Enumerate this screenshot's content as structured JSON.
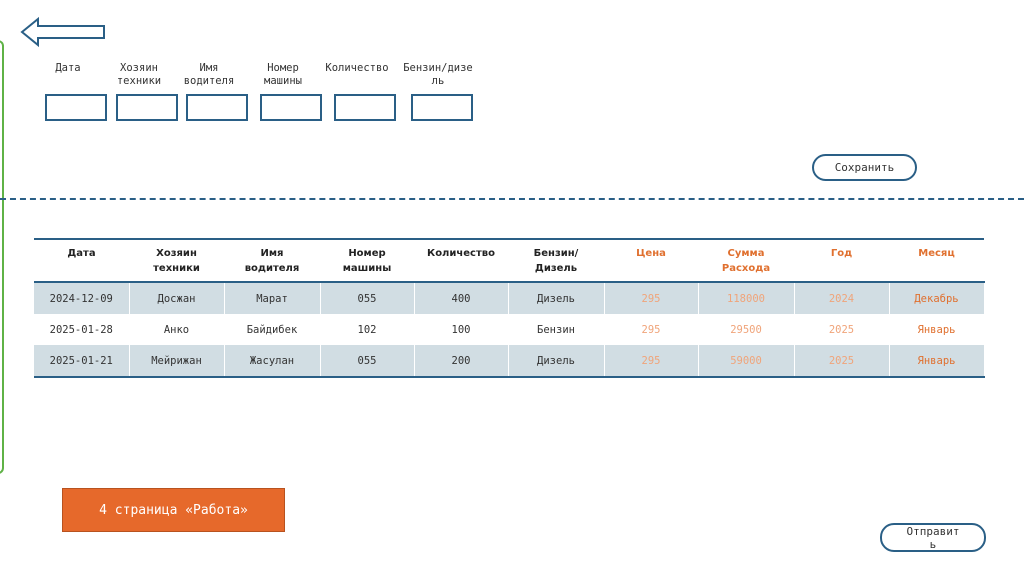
{
  "colors": {
    "accent_blue": "#2a5f86",
    "accent_orange": "#e0702f",
    "left_bar_green": "#5fb246",
    "row_stripe": "#d1dde3"
  },
  "form": {
    "labels": [
      "Дата",
      "Хозяин\nтехники",
      "Имя\nводителя",
      "Номер\nмашины",
      "Количество",
      "Бензин/дизе\nль"
    ],
    "save_label": "Сохранить"
  },
  "table": {
    "headers": [
      "Дата",
      "Хозяин\nтехники",
      "Имя\nводителя",
      "Номер\nмашины",
      "Количество",
      "Бензин/\nДизель",
      "Цена",
      "Сумма\nРасхода",
      "Год",
      "Месяц"
    ],
    "rows": [
      [
        "2024-12-09",
        "Досжан",
        "Марат",
        "055",
        "400",
        "Дизель",
        "295",
        "118000",
        "2024",
        "Декабрь"
      ],
      [
        "2025-01-28",
        "Анко",
        "Байдибек",
        "102",
        "100",
        "Бензин",
        "295",
        "29500",
        "2025",
        "Январь"
      ],
      [
        "2025-01-21",
        "Мейрижан",
        "Жасулан",
        "055",
        "200",
        "Дизель",
        "295",
        "59000",
        "2025",
        "Январь"
      ]
    ]
  },
  "footer": {
    "page_tag": "4 страница «Работа»",
    "send_label": "Отправит\nь"
  }
}
